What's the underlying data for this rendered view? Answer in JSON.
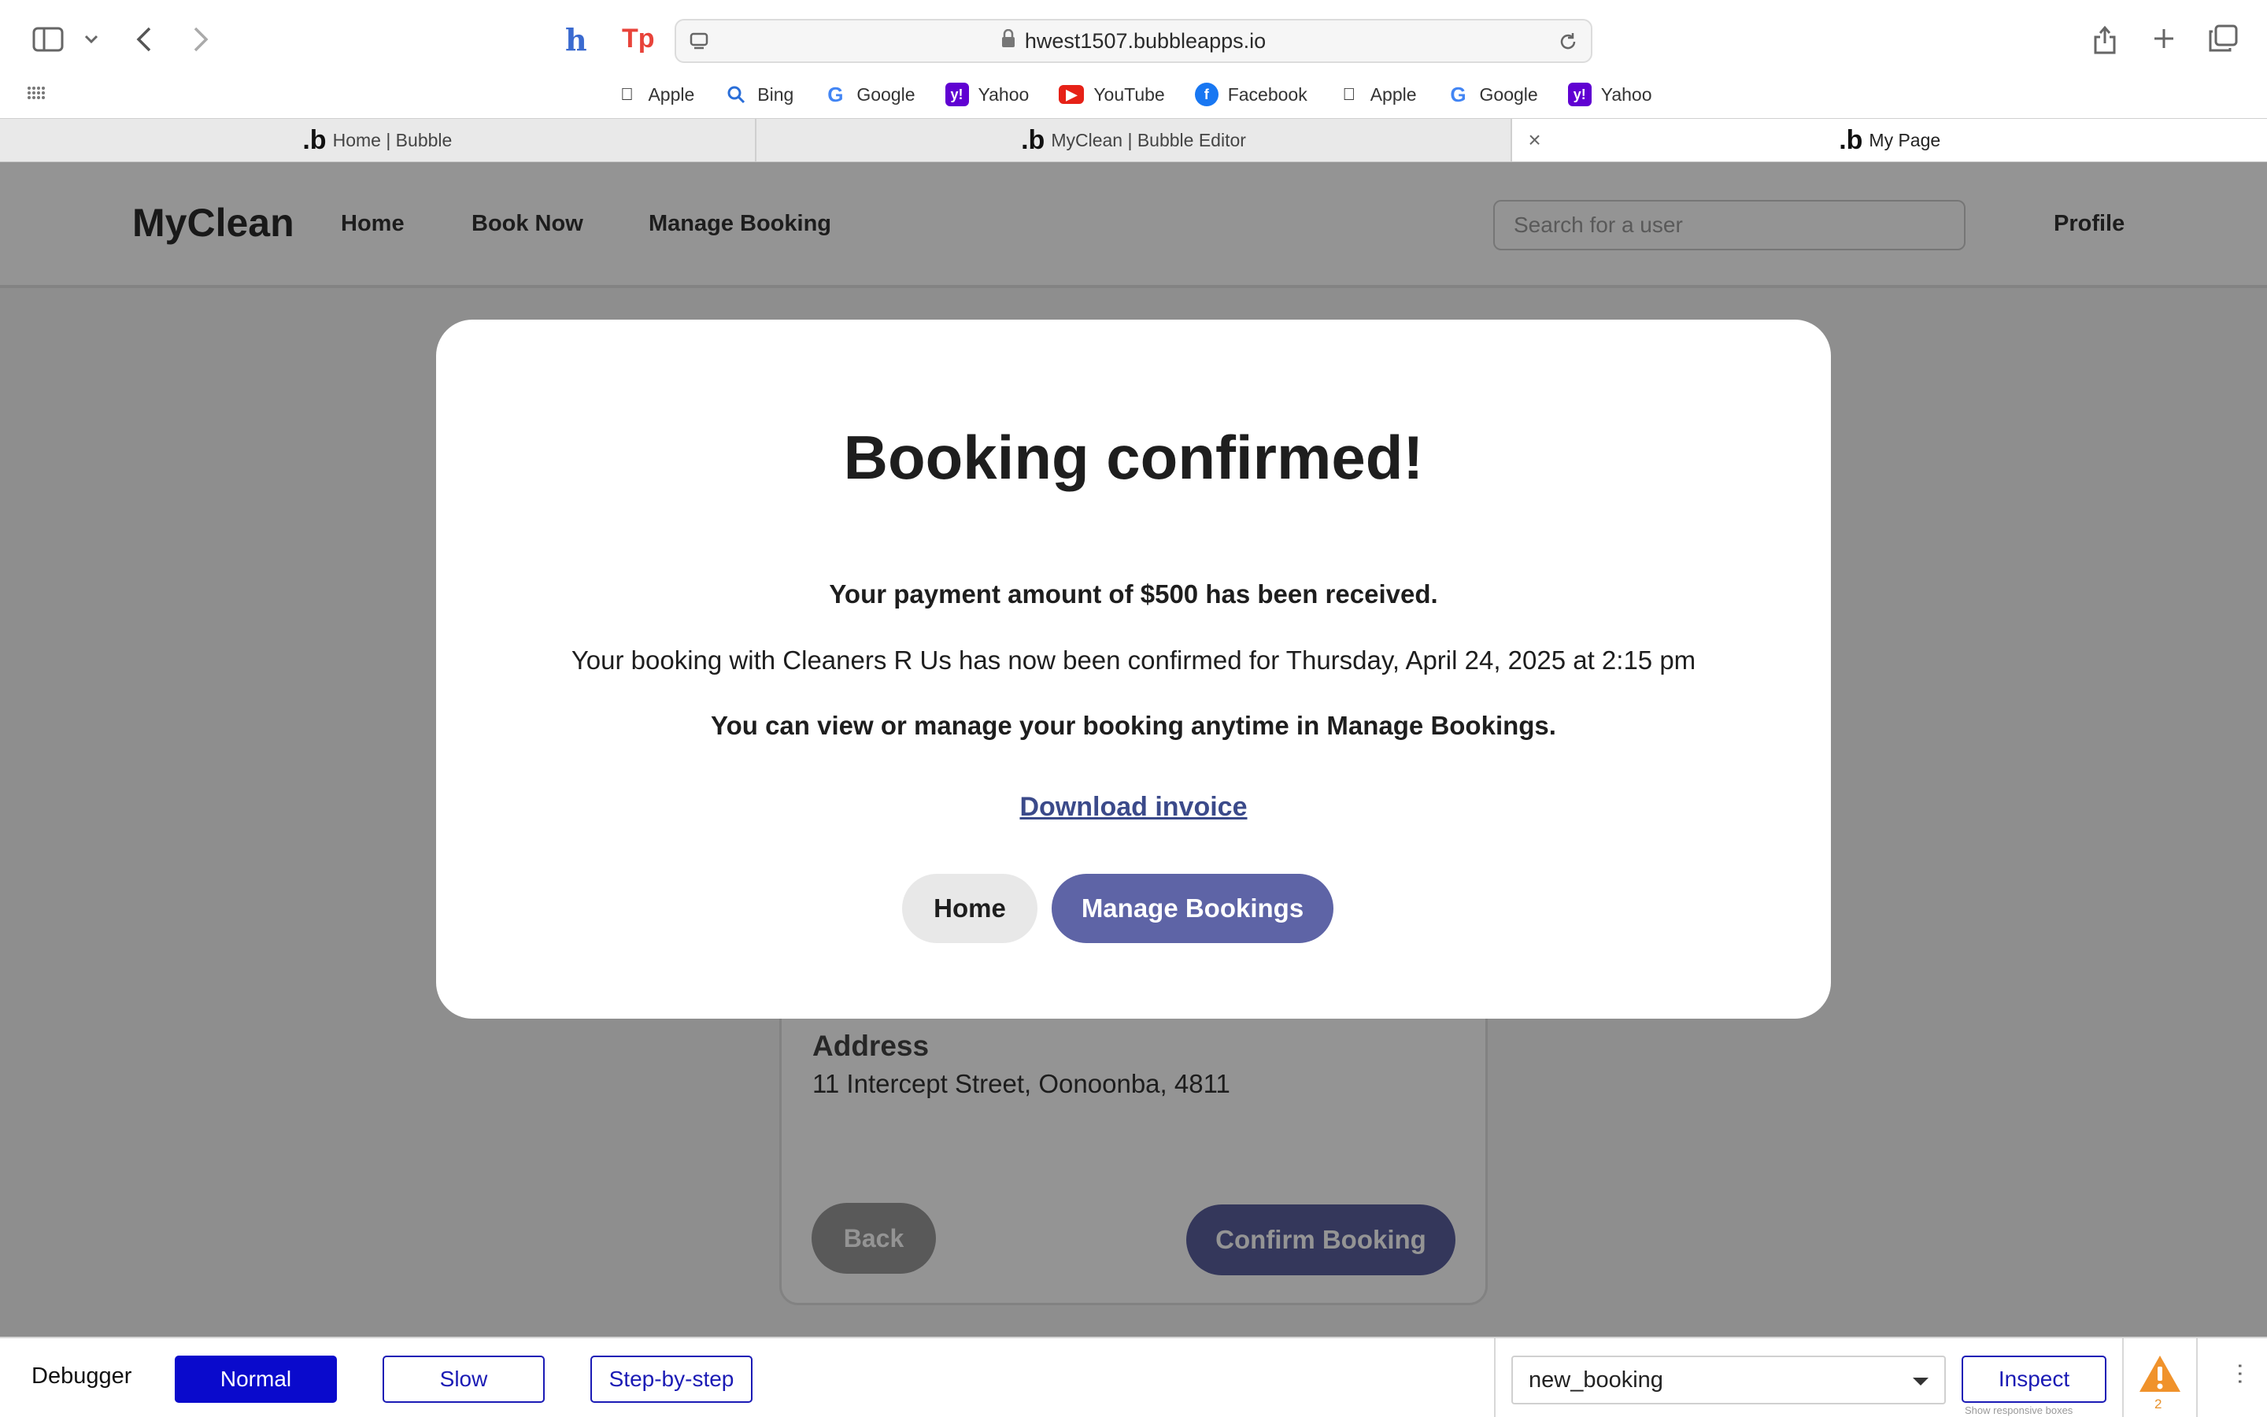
{
  "browser": {
    "url": "hwest1507.bubbleapps.io",
    "favorites": [
      {
        "label": "Apple",
        "icon": "apple-icon"
      },
      {
        "label": "Bing",
        "icon": "bing-search-icon"
      },
      {
        "label": "Google",
        "icon": "google-icon"
      },
      {
        "label": "Yahoo",
        "icon": "yahoo-icon"
      },
      {
        "label": "YouTube",
        "icon": "youtube-icon"
      },
      {
        "label": "Facebook",
        "icon": "facebook-icon"
      },
      {
        "label": "Apple",
        "icon": "apple-icon"
      },
      {
        "label": "Google",
        "icon": "google-icon"
      },
      {
        "label": "Yahoo",
        "icon": "yahoo-icon"
      }
    ],
    "tabs": [
      {
        "title": "Home | Bubble"
      },
      {
        "title": "MyClean | Bubble Editor"
      },
      {
        "title": "My Page"
      }
    ]
  },
  "app": {
    "brand": "MyClean",
    "nav": {
      "home": "Home",
      "book_now": "Book Now",
      "manage_booking": "Manage Booking"
    },
    "search_placeholder": "Search for a user",
    "profile": "Profile",
    "card": {
      "address_label": "Address",
      "address_value": "11 Intercept Street, Oonoonba, 4811",
      "back_label": "Back",
      "confirm_label": "Confirm Booking"
    }
  },
  "modal": {
    "title": "Booking confirmed!",
    "payment_line": "Your payment amount of $500 has been received.",
    "booking_line": "Your booking with Cleaners R Us has now been confirmed for Thursday, April 24, 2025 at 2:15 pm",
    "manage_line": "You can view or manage your booking anytime in Manage Bookings.",
    "download_label": "Download invoice",
    "home_label": "Home",
    "manage_label": "Manage Bookings"
  },
  "debugger": {
    "label": "Debugger",
    "normal": "Normal",
    "slow": "Slow",
    "step": "Step-by-step",
    "select_value": "new_booking",
    "inspect": "Inspect",
    "hint": "Show responsive boxes",
    "warning_count": "2"
  },
  "colors": {
    "accent": "#5e64a6",
    "debugger_blue": "#0a0acc",
    "link": "#3b4a8a",
    "warning": "#e8912a"
  }
}
